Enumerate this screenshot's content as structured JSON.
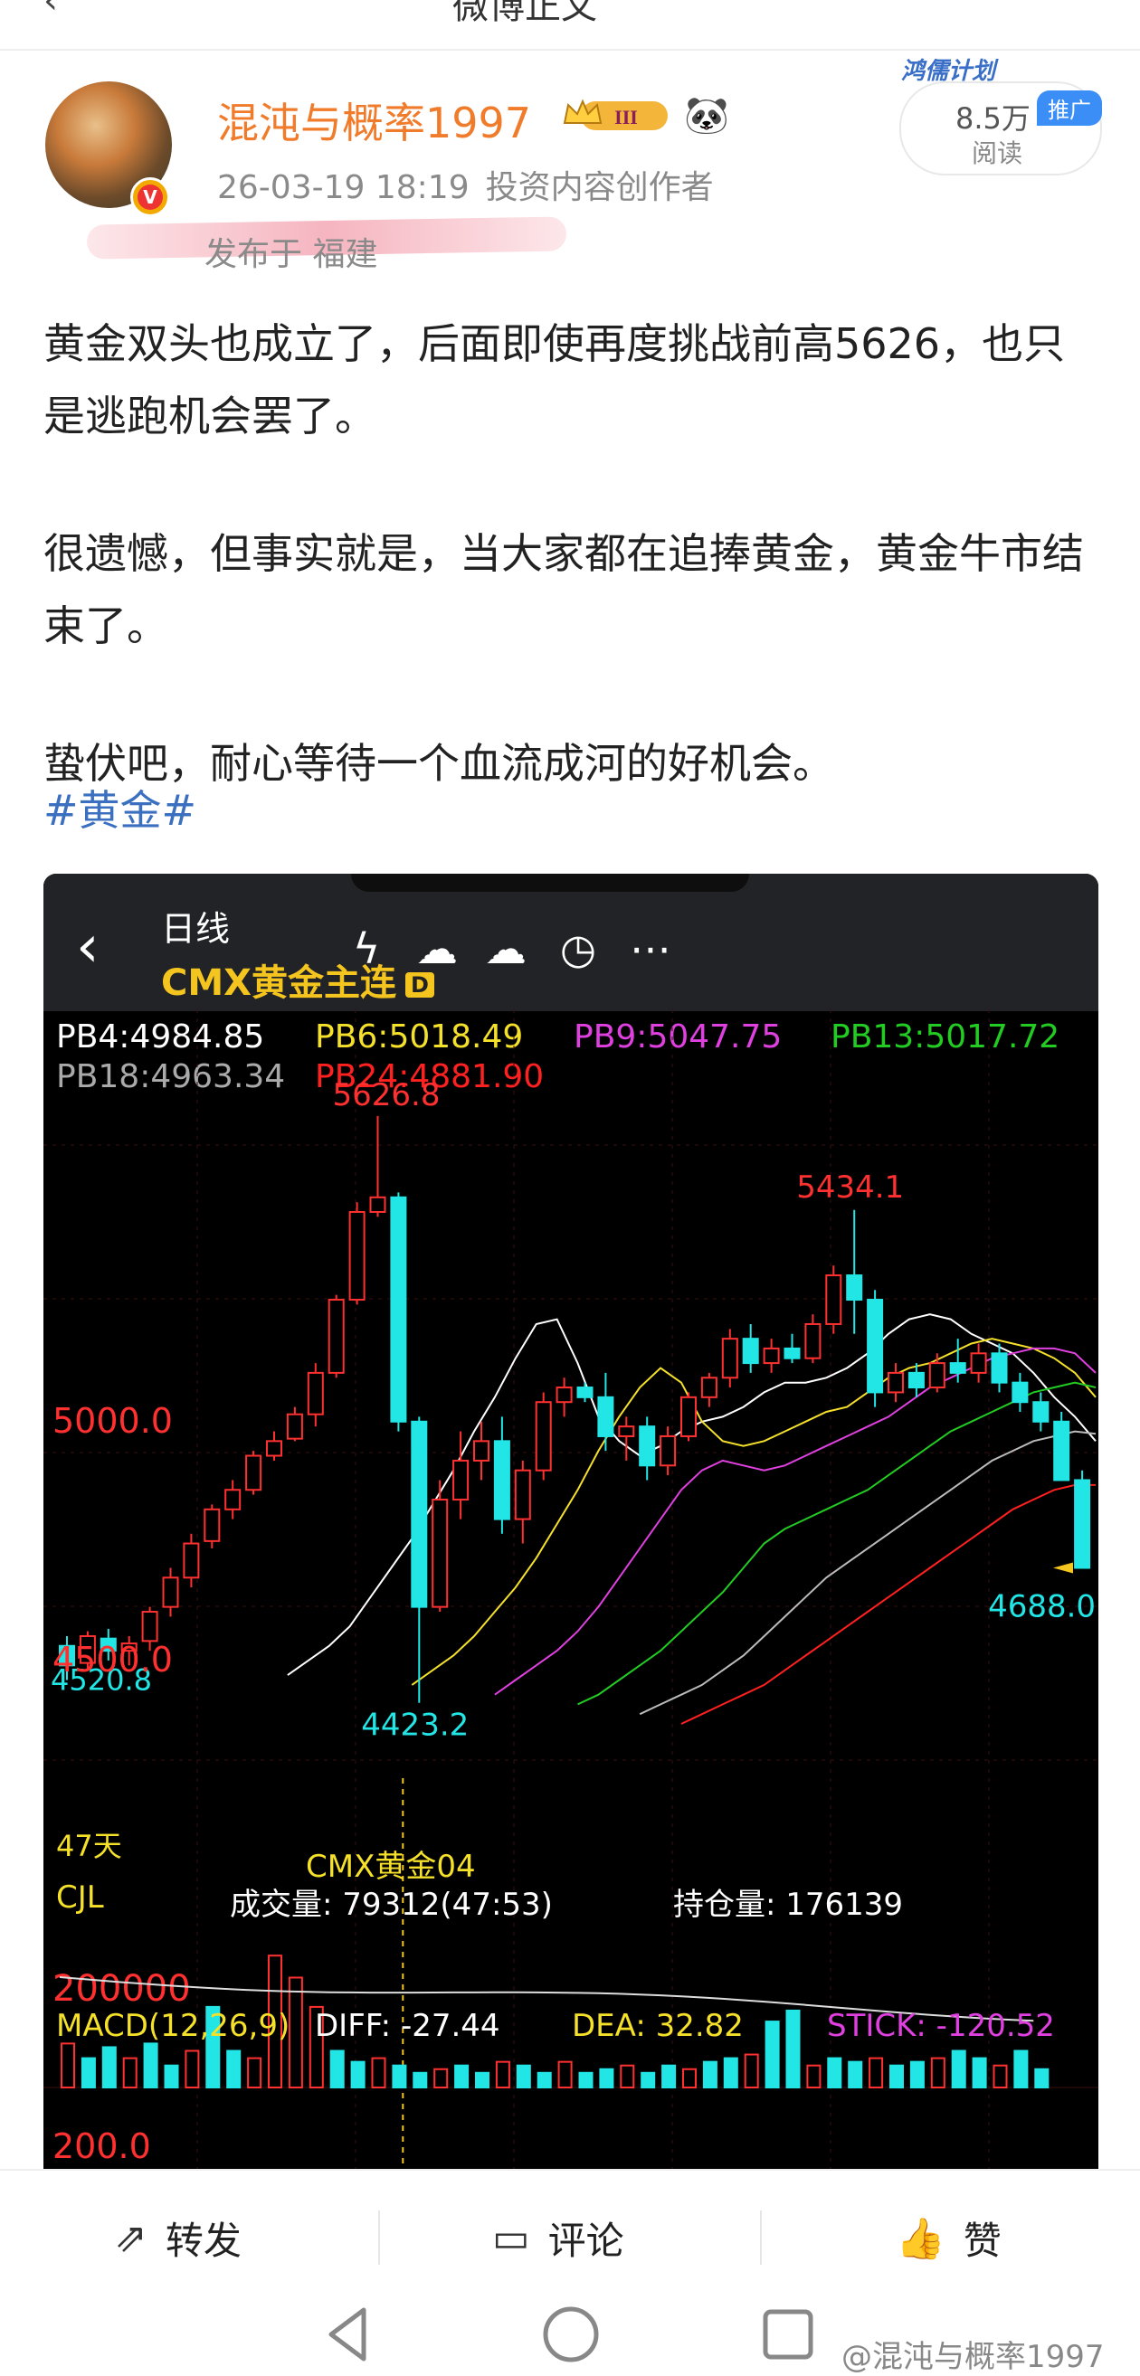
{
  "header": {
    "back_icon": "chevron-left-icon",
    "title": "微博正文"
  },
  "author": {
    "name": "混沌与概率1997",
    "level_badge": "III",
    "time": "26-03-19 18:19",
    "role": "投资内容创作者",
    "location": "发布于 福建"
  },
  "reads": {
    "promo_label": "鸿儒计划",
    "count": "8.5万",
    "label": "阅读",
    "tag": "推广"
  },
  "post": {
    "paragraphs": [
      "黄金双头也成立了，后面即使再度挑战前高5626，也只是逃跑机会罢了。",
      "很遗憾，但事实就是，当大家都在追捧黄金，黄金牛市结束了。",
      "蛰伏吧，耐心等待一个血流成河的好机会。"
    ],
    "hashtag": "#黄金#"
  },
  "chart_header": {
    "period": "日线",
    "instrument": "CMX黄金主连",
    "badge": "D",
    "icons": [
      "lightning-icon",
      "cloud-lightning-icon",
      "cloud-upload-icon",
      "clock-icon",
      "more-icon"
    ]
  },
  "indicators": {
    "pb4": "PB4:4984.85",
    "pb6": "PB6:5018.49",
    "pb9": "PB9:5047.75",
    "pb13": "PB13:5017.72",
    "pb18": "PB18:4963.34",
    "pb24": "PB24:4881.90"
  },
  "chart_data": {
    "type": "candlestick",
    "price_labels": {
      "high": "5626.8",
      "second_high": "5434.1",
      "low": "4423.2",
      "last": "4688.0",
      "left_low": "4520.8"
    },
    "y_ticks": [
      "5000.0",
      "4500.0"
    ],
    "ylim": [
      4380,
      5660
    ],
    "candles": [
      [
        4540,
        4560,
        4470,
        4500
      ],
      [
        4505,
        4570,
        4490,
        4560
      ],
      [
        4555,
        4575,
        4510,
        4530
      ],
      [
        4530,
        4560,
        4500,
        4545
      ],
      [
        4550,
        4620,
        4530,
        4610
      ],
      [
        4620,
        4700,
        4600,
        4680
      ],
      [
        4680,
        4770,
        4660,
        4750
      ],
      [
        4755,
        4830,
        4740,
        4820
      ],
      [
        4820,
        4880,
        4800,
        4860
      ],
      [
        4860,
        4940,
        4850,
        4930
      ],
      [
        4930,
        4980,
        4920,
        4960
      ],
      [
        4965,
        5030,
        4960,
        5015
      ],
      [
        5015,
        5120,
        4990,
        5100
      ],
      [
        5100,
        5260,
        5090,
        5250
      ],
      [
        5250,
        5450,
        5240,
        5430
      ],
      [
        5430,
        5626.8,
        5420,
        5460
      ],
      [
        5460,
        5470,
        4980,
        5000
      ],
      [
        5000,
        5010,
        4423.2,
        4620
      ],
      [
        4620,
        4880,
        4610,
        4840
      ],
      [
        4840,
        4980,
        4800,
        4920
      ],
      [
        4920,
        5000,
        4880,
        4960
      ],
      [
        4960,
        5010,
        4770,
        4800
      ],
      [
        4800,
        4920,
        4750,
        4900
      ],
      [
        4900,
        5060,
        4880,
        5040
      ],
      [
        5040,
        5090,
        5010,
        5070
      ],
      [
        5070,
        5080,
        5040,
        5050
      ],
      [
        5050,
        5100,
        4940,
        4970
      ],
      [
        4970,
        5010,
        4920,
        4990
      ],
      [
        4990,
        5010,
        4880,
        4910
      ],
      [
        4910,
        4990,
        4890,
        4970
      ],
      [
        4970,
        5060,
        4960,
        5050
      ],
      [
        5050,
        5100,
        5030,
        5090
      ],
      [
        5090,
        5190,
        5070,
        5170
      ],
      [
        5170,
        5200,
        5100,
        5120
      ],
      [
        5120,
        5170,
        5100,
        5150
      ],
      [
        5150,
        5180,
        5120,
        5130
      ],
      [
        5130,
        5220,
        5120,
        5200
      ],
      [
        5200,
        5320,
        5180,
        5300
      ],
      [
        5300,
        5434.1,
        5180,
        5250
      ],
      [
        5250,
        5270,
        5030,
        5060
      ],
      [
        5060,
        5120,
        5040,
        5100
      ],
      [
        5100,
        5120,
        5050,
        5070
      ],
      [
        5070,
        5140,
        5060,
        5120
      ],
      [
        5120,
        5170,
        5080,
        5100
      ],
      [
        5100,
        5160,
        5080,
        5140
      ],
      [
        5140,
        5160,
        5060,
        5080
      ],
      [
        5080,
        5100,
        5020,
        5040
      ],
      [
        5040,
        5060,
        4980,
        5000
      ],
      [
        5000,
        5020,
        4880,
        4880
      ],
      [
        4880,
        4900,
        4700,
        4700
      ]
    ],
    "moving_averages": [
      {
        "name": "PB4",
        "color": "#ffffff",
        "values": [
          4480,
          4510,
          4540,
          4580,
          4640,
          4700,
          4760,
          4830,
          4900,
          4980,
          5050,
          5130,
          5200,
          5210,
          5120,
          5010,
          4960,
          4930,
          4950,
          4980,
          5000,
          5010,
          5030,
          5060,
          5080,
          5080,
          5090,
          5110,
          5140,
          5180,
          5210,
          5220,
          5210,
          5180,
          5160,
          5140,
          5100,
          5050,
          5010,
          4960
        ]
      },
      {
        "name": "PB6",
        "color": "#f5e02a",
        "values": [
          4460,
          4490,
          4520,
          4560,
          4610,
          4660,
          4720,
          4790,
          4860,
          4940,
          5010,
          5070,
          5110,
          5080,
          5000,
          4960,
          4950,
          4960,
          4980,
          5000,
          5020,
          5030,
          5060,
          5090,
          5110,
          5120,
          5140,
          5160,
          5170,
          5160,
          5150,
          5130,
          5100,
          5050
        ]
      },
      {
        "name": "PB9",
        "color": "#e040e0",
        "values": [
          4440,
          4470,
          4500,
          4530,
          4570,
          4620,
          4680,
          4740,
          4800,
          4860,
          4900,
          4920,
          4910,
          4900,
          4910,
          4930,
          4950,
          4970,
          4990,
          5010,
          5040,
          5070,
          5090,
          5110,
          5130,
          5140,
          5150,
          5150,
          5140,
          5100
        ]
      },
      {
        "name": "PB13",
        "color": "#22cc22",
        "values": [
          4420,
          4440,
          4470,
          4500,
          4530,
          4570,
          4610,
          4650,
          4700,
          4750,
          4780,
          4800,
          4820,
          4840,
          4860,
          4890,
          4920,
          4950,
          4980,
          5000,
          5020,
          5040,
          5060,
          5070,
          5080,
          5070
        ]
      },
      {
        "name": "PB18",
        "color": "#bbbbbb",
        "values": [
          4400,
          4420,
          4440,
          4460,
          4490,
          4520,
          4560,
          4600,
          4640,
          4680,
          4710,
          4740,
          4770,
          4800,
          4830,
          4860,
          4890,
          4920,
          4940,
          4960,
          4970,
          4980,
          4975
        ]
      },
      {
        "name": "PB24",
        "color": "#ff2020",
        "values": [
          4380,
          4400,
          4420,
          4440,
          4460,
          4490,
          4520,
          4550,
          4580,
          4610,
          4640,
          4670,
          4700,
          4730,
          4760,
          4790,
          4820,
          4840,
          4860,
          4870,
          4870
        ]
      }
    ]
  },
  "lower_panel": {
    "days": "47天",
    "contract": "CMX黄金04",
    "cjl": "CJL",
    "volume": "成交量: 79312(47:53)",
    "open_interest": "持仓量: 176139",
    "vol_tick": "200000",
    "volumes": [
      60,
      40,
      55,
      40,
      60,
      30,
      50,
      110,
      50,
      40,
      180,
      150,
      110,
      50,
      35,
      40,
      30,
      20,
      25,
      30,
      20,
      35,
      30,
      20,
      35,
      20,
      25,
      30,
      20,
      30,
      25,
      35,
      40,
      45,
      90,
      105,
      30,
      40,
      35,
      40,
      30,
      35,
      40,
      50,
      40,
      30,
      50,
      25
    ],
    "macd_label": "MACD(12,26,9)",
    "diff": "DIFF: -27.44",
    "dea": "DEA: 32.82",
    "stick": "STICK: -120.52",
    "macd_tick": "200.0"
  },
  "actions": {
    "repost": "转发",
    "comment": "评论",
    "like": "赞"
  },
  "watermark": "@混沌与概率1997"
}
